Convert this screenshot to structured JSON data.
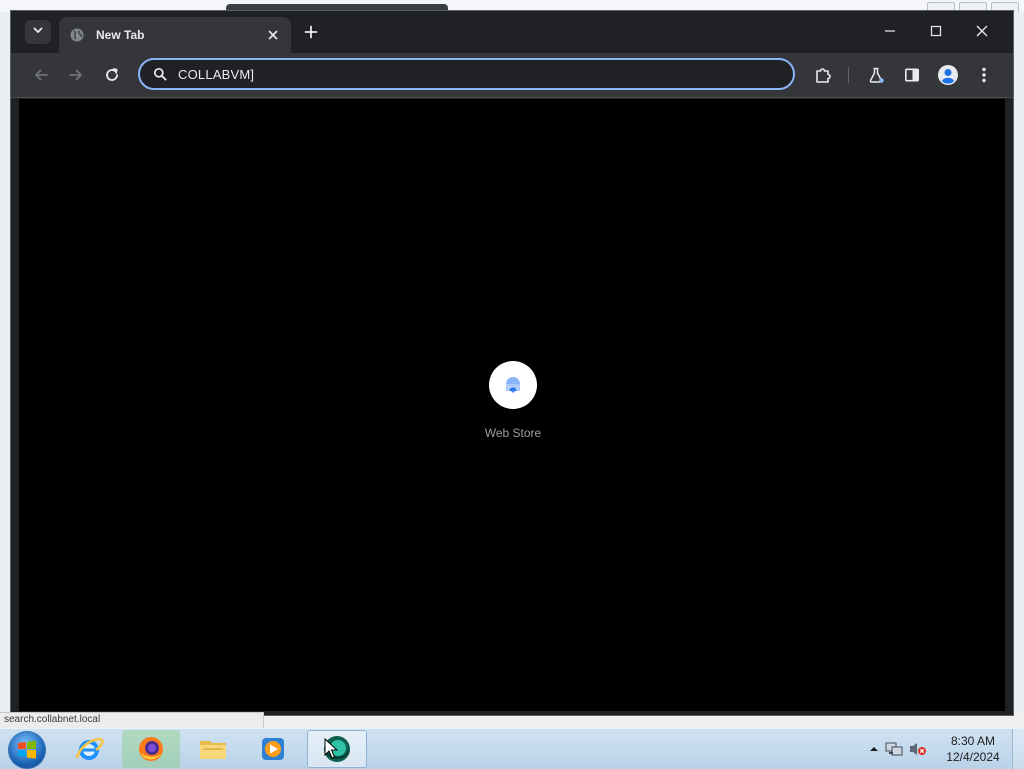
{
  "browser": {
    "tab": {
      "title": "New Tab"
    },
    "omnibox": {
      "value": "COLLABVM]"
    },
    "shortcut": {
      "label": "Web Store"
    }
  },
  "status_bar": {
    "text": "search.collabnet.local"
  },
  "taskbar": {
    "clock": {
      "time": "8:30 AM",
      "date": "12/4/2024"
    }
  },
  "colors": {
    "accent": "#8ab4f8",
    "tab_bg": "#35363a",
    "content_bg": "#000000"
  }
}
